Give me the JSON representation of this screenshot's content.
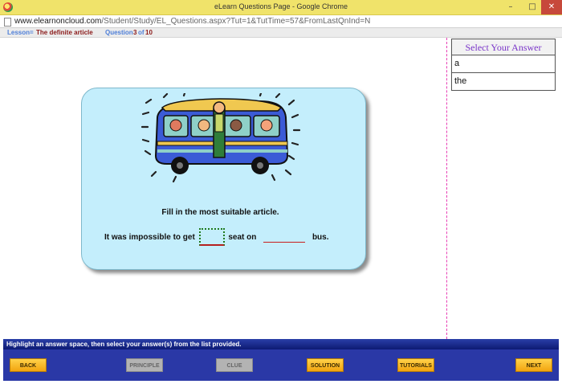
{
  "window": {
    "title": "eLearn Questions Page - Google Chrome",
    "url_domain": "www.elearnoncloud.com",
    "url_path": "/Student/Study/EL_Questions.aspx?Tut=1&TutTime=57&FromLastQnInd=N",
    "controls": {
      "minimize": "–",
      "maximize": "□",
      "close": "✕"
    }
  },
  "info": {
    "lesson_label": "Lesson",
    "lesson_sep": "=",
    "lesson_value": "The definite article",
    "question_label": "Question",
    "question_current": "3",
    "question_of": "of",
    "question_total": "10"
  },
  "answers": {
    "heading": "Select Your Answer",
    "options": [
      "a",
      "the"
    ]
  },
  "question": {
    "instruction": "Fill in the most suitable article.",
    "part1": "It was impossible to get",
    "part2": "seat on",
    "part3": "bus."
  },
  "hint": "Highlight an answer space, then select your answer(s) from the list provided.",
  "nav": {
    "back": "BACK",
    "principle": "PRINCIPLE",
    "clue": "CLUE",
    "solution": "SOLUTION",
    "tutorials": "TUTORIALS",
    "next": "NEXT"
  },
  "icons": {
    "app": "chrome-icon",
    "page": "page-icon",
    "illustration": "bus-illustration"
  },
  "colors": {
    "titlebar": "#f0e36a",
    "card": "#c4eefc",
    "navbar": "#2a38a6",
    "button": "#f2a40f",
    "divider": "#e83fb5"
  }
}
